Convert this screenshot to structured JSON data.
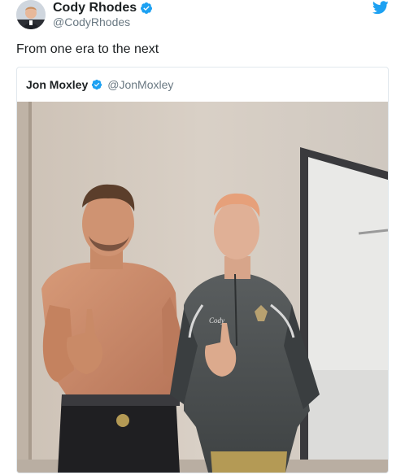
{
  "tweet": {
    "author_name": "Cody Rhodes",
    "author_handle": "@CodyRhodes",
    "text": "From one era to the next",
    "verified": true,
    "platform_icon": "twitter-bird-icon"
  },
  "quoted_tweet": {
    "author_name": "Jon Moxley",
    "author_handle": "@JonMoxley",
    "verified": true,
    "photo": {
      "subject": "two-wrestlers-photo",
      "shirt_text": "Cody"
    }
  },
  "colors": {
    "brand_blue": "#1da1f2",
    "text_primary": "#1c2022",
    "text_secondary": "#697882",
    "border": "#e1e8ed"
  }
}
